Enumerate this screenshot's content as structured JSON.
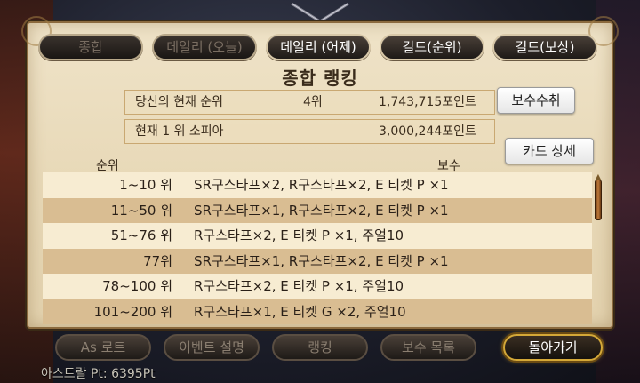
{
  "tabs": [
    {
      "label": "종합",
      "enabled": false
    },
    {
      "label": "데일리 (오늘)",
      "enabled": false
    },
    {
      "label": "데일리 (어제)",
      "enabled": true
    },
    {
      "label": "길드(순위)",
      "enabled": true
    },
    {
      "label": "길드(보상)",
      "enabled": true
    }
  ],
  "title": "종합 랭킹",
  "my_rank": {
    "label": "당신의 현재 순위",
    "rank": "4위",
    "points": "1,743,715포인트"
  },
  "top_rank": {
    "label": "현재 1 위  소피아",
    "points": "3,000,244포인트"
  },
  "buttons": {
    "claim": "보수수취",
    "card_detail": "카드 상세"
  },
  "table": {
    "headers": {
      "rank": "순위",
      "reward": "보수"
    },
    "rows": [
      {
        "rank": "1~10 위",
        "reward": "SR구스타프×2, R구스타프×2, E 티켓 P ×1"
      },
      {
        "rank": "11~50 위",
        "reward": "SR구스타프×1, R구스타프×2, E 티켓 P ×1"
      },
      {
        "rank": "51~76 위",
        "reward": "R구스타프×2, E 티켓 P ×1, 주얼10"
      },
      {
        "rank": "77위",
        "reward": "SR구스타프×1, R구스타프×2, E 티켓 P ×1"
      },
      {
        "rank": "78~100 위",
        "reward": "R구스타프×2, E 티켓 P ×1, 주얼10"
      },
      {
        "rank": "101~200 위",
        "reward": "R구스타프×1, E 티켓 G ×2, 주얼10"
      }
    ]
  },
  "bottom_nav": [
    {
      "label": "As 로트",
      "active": false
    },
    {
      "label": "이벤트 설명",
      "active": false
    },
    {
      "label": "랭킹",
      "active": false
    },
    {
      "label": "보수 목록",
      "active": false
    },
    {
      "label": "돌아가기",
      "active": true
    }
  ],
  "status": "아스트랄 Pt: 6395Pt",
  "colors": {
    "panel": "#e8d9b8",
    "row_light": "#f7ecd2",
    "row_dark": "#d9bd92",
    "accent_gold": "#d4a838"
  }
}
